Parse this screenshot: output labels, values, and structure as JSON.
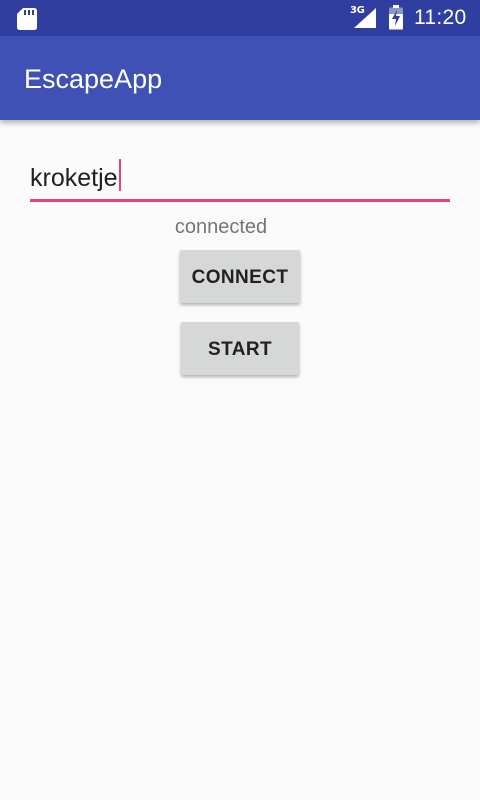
{
  "status_bar": {
    "time": "11:20",
    "network_type": "3G",
    "icons": [
      "sd-card-icon",
      "signal-icon",
      "battery-charging-icon"
    ],
    "background_color": "#303f9f"
  },
  "app_bar": {
    "title": "EscapeApp",
    "background_color": "#3f51b5"
  },
  "name_input": {
    "value": "kroketje",
    "accent_color": "#ec407a"
  },
  "connection_status": "connected",
  "buttons": {
    "connect_label": "CONNECT",
    "start_label": "START"
  }
}
